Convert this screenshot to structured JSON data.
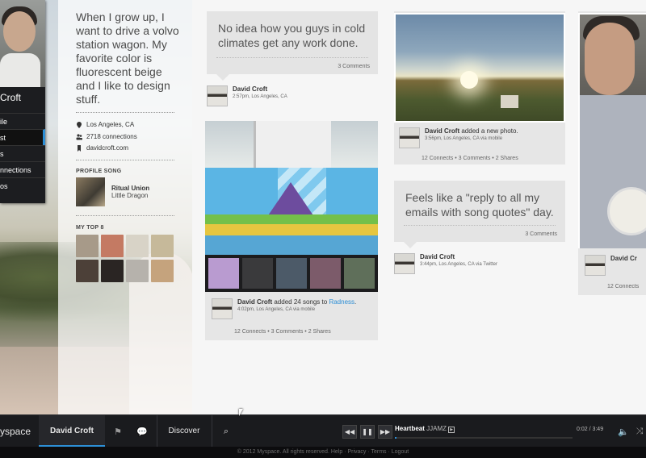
{
  "profile": {
    "name": "Croft",
    "menu": [
      "ile",
      "st",
      "s",
      "nnections",
      "os"
    ],
    "bio": "When I grow up, I want to drive a volvo station wagon. My favorite color is fluorescent beige and I like to design stuff.",
    "location": "Los Angeles, CA",
    "connections": "2718 connections",
    "website": "davidcroft.com",
    "profile_song_label": "PROFILE SONG",
    "song_title": "Ritual Union",
    "song_artist": "Little Dragon",
    "top8_label": "MY TOP 8",
    "icons": {
      "location": "pin-icon",
      "connections": "people-icon",
      "website": "bookmark-icon"
    }
  },
  "posts": {
    "cold": {
      "quote": "No idea how you guys in cold climates get any work done.",
      "comments": "3 Comments",
      "author": "David Croft",
      "meta": "2:57pm, Los Angeles, CA"
    },
    "songs": {
      "author": "David Croft",
      "action": "added 24 songs to",
      "link": "Radness",
      "period": ".",
      "meta": "4:02pm, Los Angeles, CA via mobile",
      "connects": "12 Connects",
      "comments": "3 Comments",
      "shares": "2 Shares"
    },
    "photo": {
      "author": "David Croft",
      "action": "added a new photo.",
      "meta": "3:56pm, Los Angeles, CA via mobile",
      "connects": "12 Connects",
      "comments": "3 Comments",
      "shares": "2 Shares"
    },
    "reply": {
      "quote": "Feels like a \"reply to all my emails with song quotes\" day.",
      "comments": "3 Comments",
      "author": "David Croft",
      "meta": "3:44pm, Los Angeles, CA via Twitter"
    },
    "portrait": {
      "author": "David Cr",
      "connects": "12 Connects"
    }
  },
  "bar": {
    "logo": "yspace",
    "me_tab": "David Croft",
    "discover": "Discover",
    "track": "Heartbeat",
    "artist": "JJAMZ",
    "time": "0:02 / 3:49",
    "progress": 0.01,
    "accent": "#2d8fd6"
  },
  "footer": "© 2012 Myspace. All rights reserved. Help · Privacy · Terms · Logout"
}
